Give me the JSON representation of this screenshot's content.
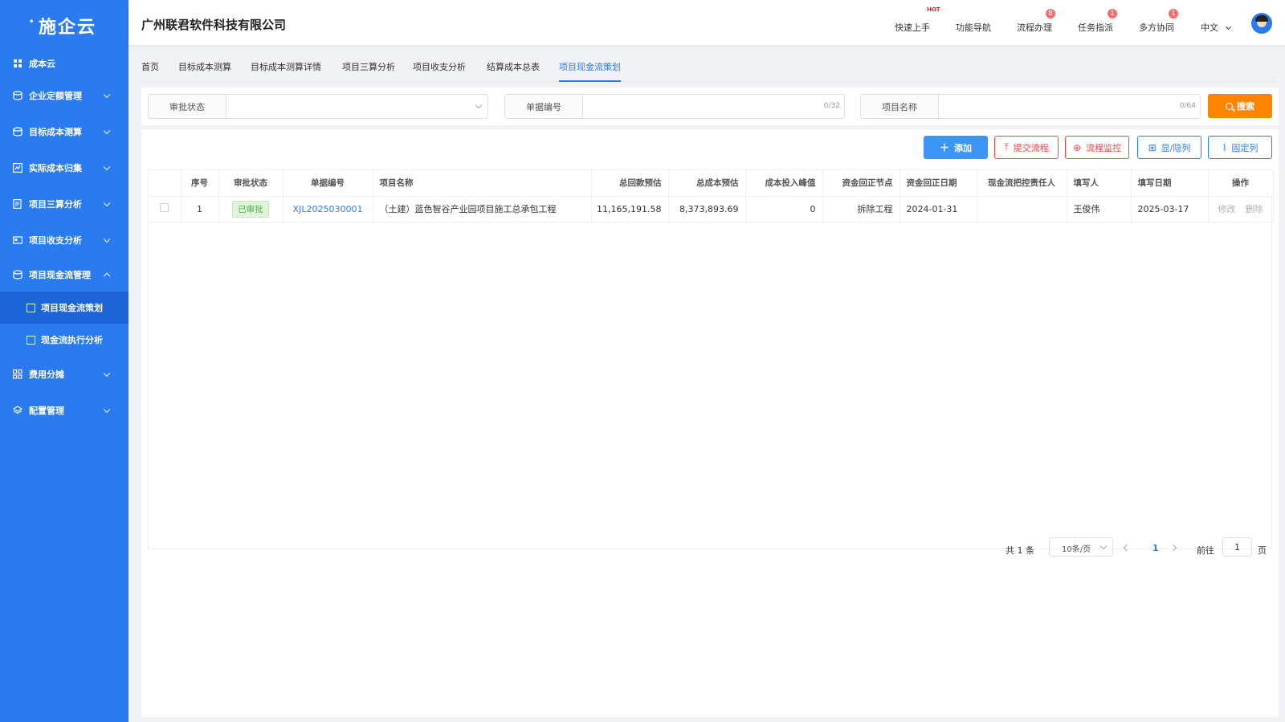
{
  "sidebar": {
    "logo": "施企云",
    "items": [
      {
        "label": "成本云",
        "icon": "grid-icon"
      },
      {
        "label": "企业定额管理",
        "icon": "db-icon"
      },
      {
        "label": "目标成本测算",
        "icon": "db-icon"
      },
      {
        "label": "实际成本归集",
        "icon": "chart-icon"
      },
      {
        "label": "项目三算分析",
        "icon": "doc-icon"
      },
      {
        "label": "项目收支分析",
        "icon": "card-icon"
      },
      {
        "label": "项目现金流管理",
        "icon": "db-icon"
      },
      {
        "label": "费用分摊",
        "icon": "grid-icon"
      },
      {
        "label": "配置管理",
        "icon": "layers-icon"
      }
    ],
    "sub_items": [
      {
        "label": "项目现金流策划"
      },
      {
        "label": "现金流执行分析"
      }
    ]
  },
  "header": {
    "company": "广州联君软件科技有限公司",
    "nav": [
      {
        "label": "快速上手",
        "badge": ""
      },
      {
        "label": "功能导航",
        "badge": ""
      },
      {
        "label": "流程办理",
        "badge": "8"
      },
      {
        "label": "任务指派",
        "badge": "1"
      },
      {
        "label": "多方协同",
        "badge": "1"
      }
    ],
    "hot": "HOT",
    "lang": "中文"
  },
  "tabs": [
    "首页",
    "目标成本测算",
    "目标成本测算详情",
    "项目三算分析",
    "项目收支分析",
    "结算成本总表",
    "项目现金流策划"
  ],
  "search": {
    "fields": [
      {
        "label": "审批状态",
        "counter": ""
      },
      {
        "label": "单据编号",
        "counter": "0/32"
      },
      {
        "label": "项目名称",
        "counter": "0/64"
      }
    ],
    "button": "搜索"
  },
  "toolbar": {
    "add": "添加",
    "submit": "提交流程",
    "monitor": "流程监控",
    "toggle_cols": "显/隐列",
    "fix_cols": "固定列"
  },
  "table": {
    "headers": [
      "序号",
      "审批状态",
      "单据编号",
      "项目名称",
      "总回款预估",
      "总成本预估",
      "成本投入峰值",
      "资金回正节点",
      "资金回正日期",
      "现金流把控责任人",
      "填写人",
      "填写日期",
      "操作"
    ],
    "rows": [
      {
        "index": "1",
        "status": "已审批",
        "code": "XJL2025030001",
        "name": "（土建）蓝色智谷产业园项目施工总承包工程",
        "revenue": "11,165,191.58",
        "cost": "8,373,893.69",
        "peak": "0",
        "node": "拆除工程",
        "date": "2024-01-31",
        "owner": "",
        "writer": "王俊伟",
        "write_date": "2025-03-17",
        "op_edit": "修改",
        "op_delete": "删除"
      }
    ]
  },
  "pagination": {
    "total_prefix": "共",
    "total": "1",
    "total_suffix": "条",
    "page_size": "10条/页",
    "current": "1",
    "goto_prefix": "前往",
    "goto_value": "1",
    "goto_suffix": "页"
  },
  "colors": {
    "primary": "#2b7bf0",
    "search_button": "#ff8400",
    "danger": "#e84a4a",
    "badge": "#f56c6c"
  }
}
